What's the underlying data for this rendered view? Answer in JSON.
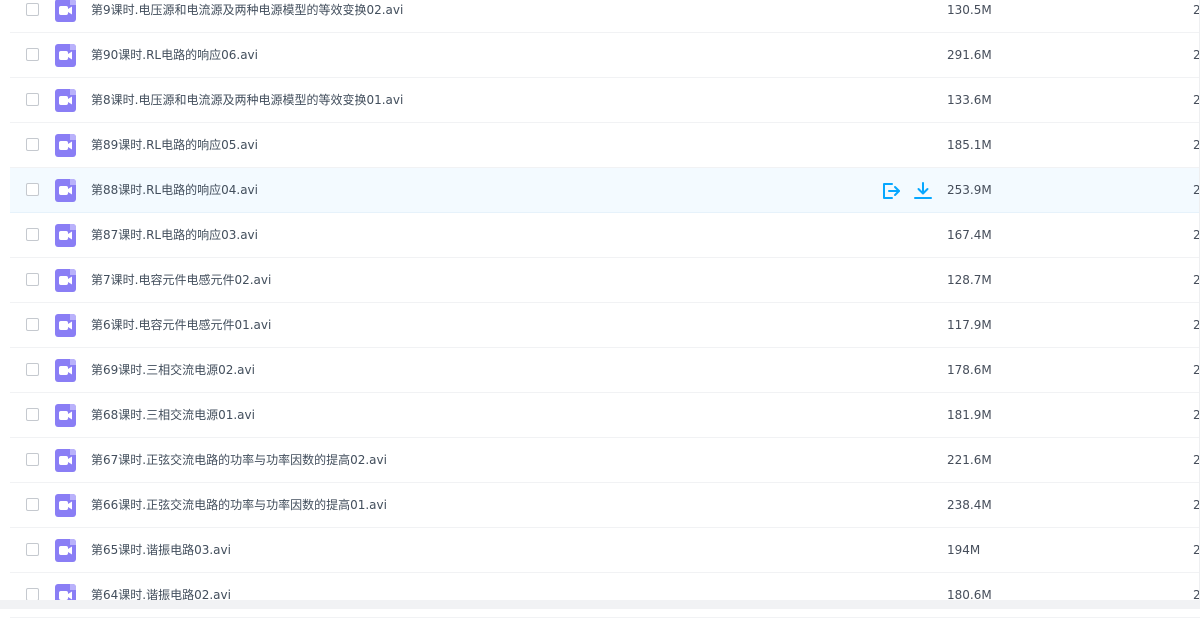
{
  "colors": {
    "video_icon": "#8a7ef5",
    "action_icon": "#06a7ff",
    "hover_row": "#f3faff"
  },
  "actions": {
    "share_icon": "share-export-icon",
    "download_icon": "download-icon"
  },
  "files": [
    {
      "name": "第9课时.电压源和电流源及两种电源模型的等效变换02.avi",
      "size": "130.5M",
      "date": "2"
    },
    {
      "name": "第90课时.RL电路的响应06.avi",
      "size": "291.6M",
      "date": "2"
    },
    {
      "name": "第8课时.电压源和电流源及两种电源模型的等效变换01.avi",
      "size": "133.6M",
      "date": "2"
    },
    {
      "name": "第89课时.RL电路的响应05.avi",
      "size": "185.1M",
      "date": "2"
    },
    {
      "name": "第88课时.RL电路的响应04.avi",
      "size": "253.9M",
      "date": "2",
      "hover": true
    },
    {
      "name": "第87课时.RL电路的响应03.avi",
      "size": "167.4M",
      "date": "2"
    },
    {
      "name": "第7课时.电容元件电感元件02.avi",
      "size": "128.7M",
      "date": "2"
    },
    {
      "name": "第6课时.电容元件电感元件01.avi",
      "size": "117.9M",
      "date": "2"
    },
    {
      "name": "第69课时.三相交流电源02.avi",
      "size": "178.6M",
      "date": "2"
    },
    {
      "name": "第68课时.三相交流电源01.avi",
      "size": "181.9M",
      "date": "2"
    },
    {
      "name": "第67课时.正弦交流电路的功率与功率因数的提高02.avi",
      "size": "221.6M",
      "date": "2"
    },
    {
      "name": "第66课时.正弦交流电路的功率与功率因数的提高01.avi",
      "size": "238.4M",
      "date": "2"
    },
    {
      "name": "第65课时.谐振电路03.avi",
      "size": "194M",
      "date": "2"
    },
    {
      "name": "第64课时.谐振电路02.avi",
      "size": "180.6M",
      "date": "2"
    }
  ]
}
